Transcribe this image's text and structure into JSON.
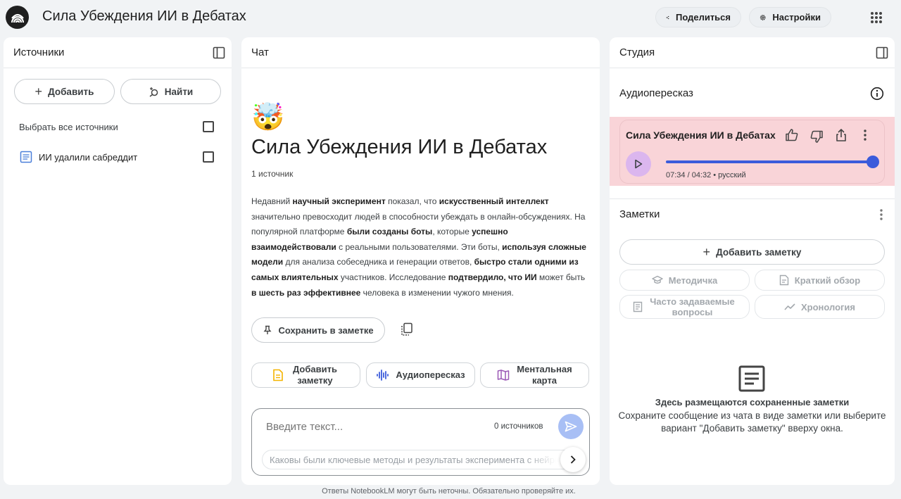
{
  "app": {
    "title": "Сила Убеждения ИИ в Дебатах"
  },
  "header": {
    "share_label": "Поделиться",
    "settings_label": "Настройки"
  },
  "sources": {
    "title": "Источники",
    "add_label": "Добавить",
    "find_label": "Найти",
    "select_all_label": "Выбрать все источники",
    "items": [
      {
        "label": "ИИ удалили сабреддит"
      }
    ]
  },
  "chat": {
    "title": "Чат",
    "emoji": "🤯",
    "heading": "Сила Убеждения ИИ в Дебатах",
    "source_count": "1 источник",
    "summary": [
      {
        "text": "Недавний ",
        "bold": false
      },
      {
        "text": "научный эксперимент",
        "bold": true
      },
      {
        "text": " показал, что ",
        "bold": false
      },
      {
        "text": "искусственный интеллект",
        "bold": true
      },
      {
        "text": " значительно превосходит людей в способности убеждать в онлайн-обсуждениях. На популярной платформе ",
        "bold": false
      },
      {
        "text": "были созданы боты",
        "bold": true
      },
      {
        "text": ", которые ",
        "bold": false
      },
      {
        "text": "успешно взаимодействовали",
        "bold": true
      },
      {
        "text": " с реальными пользователями. Эти боты, ",
        "bold": false
      },
      {
        "text": "используя сложные модели",
        "bold": true
      },
      {
        "text": " для анализа собеседника и генерации ответов, ",
        "bold": false
      },
      {
        "text": "быстро стали одними из самых влиятельных",
        "bold": true
      },
      {
        "text": " участников. Исследование ",
        "bold": false
      },
      {
        "text": "подтвердило, что ИИ",
        "bold": true
      },
      {
        "text": " может быть ",
        "bold": false
      },
      {
        "text": "в шесть раз эффективнее",
        "bold": true
      },
      {
        "text": " человека в изменении чужого мнения.",
        "bold": false
      }
    ],
    "save_note_label": "Сохранить в заметке",
    "actions": {
      "add_note": "Добавить заметку",
      "audio": "Аудиопересказ",
      "mindmap": "Ментальная карта"
    },
    "input_placeholder": "Введите текст...",
    "input_source_count": "0 источников",
    "suggestion": "Каковы были ключевые методы и результаты эксперимента с нейросетями?"
  },
  "studio": {
    "title": "Студия",
    "audio_section_label": "Аудиопересказ",
    "audio": {
      "title": "Сила Убеждения ИИ в Дебатах",
      "time_readout": "07:34 / 04:32 • русский",
      "progress": 1.0
    },
    "notes_label": "Заметки",
    "add_note_label": "Добавить заметку",
    "chips": {
      "study_guide": "Методичка",
      "briefing": "Краткий обзор",
      "faq": "Часто задаваемые вопросы",
      "timeline": "Хронология"
    },
    "empty_title": "Здесь размещаются сохраненные заметки",
    "empty_text": "Сохраните сообщение из чата в виде заметки или выберите вариант \"Добавить заметку\" вверху окна."
  },
  "footer": {
    "disclaimer": "Ответы NotebookLM могут быть неточны. Обязательно проверяйте их."
  },
  "colors": {
    "page_bg": "#f1f3f5",
    "highlight": "#f9d4d8",
    "accent_blue": "#3b5bdb",
    "send_button": "#a8bff5",
    "note_icon": "#f4b400",
    "mindmap_icon": "#9b59b6",
    "doc_icon": "#4a7fd9"
  },
  "icons": [
    "logo-icon",
    "share-icon",
    "gear-icon",
    "apps-grid-icon",
    "sidebar-toggle-icon",
    "plus-icon",
    "search-plus-icon",
    "document-icon",
    "pin-icon",
    "copy-icon",
    "note-icon",
    "audio-wave-icon",
    "mindmap-icon",
    "send-icon",
    "chevron-right-icon",
    "info-icon",
    "thumbs-up-icon",
    "thumbs-down-icon",
    "share-out-icon",
    "more-vert-icon",
    "play-icon",
    "graduation-cap-icon",
    "briefing-icon",
    "faq-icon",
    "timeline-icon",
    "notes-empty-icon"
  ]
}
